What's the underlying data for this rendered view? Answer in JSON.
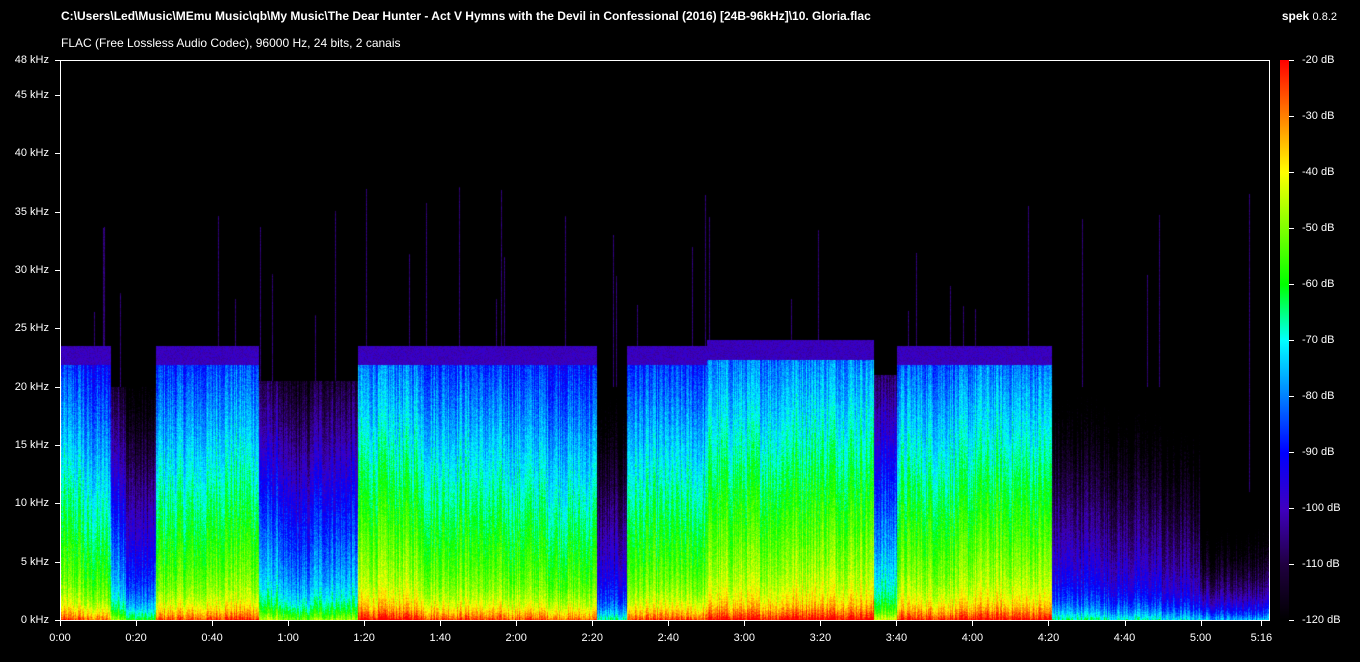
{
  "header": {
    "file_path": "C:\\Users\\Led\\Music\\MEmu Music\\qb\\My Music\\The Dear Hunter - Act V Hymns with the Devil in Confessional (2016) [24B-96kHz]\\10. Gloria.flac",
    "format_info": "FLAC (Free Lossless Audio Codec), 96000 Hz, 24 bits, 2 canais",
    "app_name": "spek",
    "app_version": "0.8.2"
  },
  "chart_data": {
    "type": "heatmap",
    "x_axis": {
      "unit": "time",
      "range_seconds": [
        0,
        318
      ],
      "ticks": [
        {
          "label": "0:00",
          "value": 0
        },
        {
          "label": "0:20",
          "value": 20
        },
        {
          "label": "0:40",
          "value": 40
        },
        {
          "label": "1:00",
          "value": 60
        },
        {
          "label": "1:20",
          "value": 80
        },
        {
          "label": "1:40",
          "value": 100
        },
        {
          "label": "2:00",
          "value": 120
        },
        {
          "label": "2:20",
          "value": 140
        },
        {
          "label": "2:40",
          "value": 160
        },
        {
          "label": "3:00",
          "value": 180
        },
        {
          "label": "3:20",
          "value": 200
        },
        {
          "label": "3:40",
          "value": 220
        },
        {
          "label": "4:00",
          "value": 240
        },
        {
          "label": "4:20",
          "value": 260
        },
        {
          "label": "4:40",
          "value": 280
        },
        {
          "label": "5:00",
          "value": 300
        },
        {
          "label": "5:16",
          "value": 316
        }
      ]
    },
    "y_axis": {
      "unit": "kHz",
      "range": [
        0,
        48
      ],
      "ticks": [
        {
          "label": "0 kHz",
          "value": 0
        },
        {
          "label": "5 kHz",
          "value": 5
        },
        {
          "label": "10 kHz",
          "value": 10
        },
        {
          "label": "15 kHz",
          "value": 15
        },
        {
          "label": "20 kHz",
          "value": 20
        },
        {
          "label": "25 kHz",
          "value": 25
        },
        {
          "label": "30 kHz",
          "value": 30
        },
        {
          "label": "35 kHz",
          "value": 35
        },
        {
          "label": "40 kHz",
          "value": 40
        },
        {
          "label": "45 kHz",
          "value": 45
        },
        {
          "label": "48 kHz",
          "value": 48
        }
      ]
    },
    "colorbar": {
      "unit": "dB",
      "range": [
        -120,
        -20
      ],
      "colors_top_to_bottom": [
        "#ff0000",
        "#ff8000",
        "#ffff00",
        "#80ff00",
        "#00ff00",
        "#00ffff",
        "#0080ff",
        "#0000ff",
        "#4000c0",
        "#200040",
        "#000000"
      ],
      "ticks": [
        {
          "label": "-20 dB",
          "value": -20
        },
        {
          "label": "-30 dB",
          "value": -30
        },
        {
          "label": "-40 dB",
          "value": -40
        },
        {
          "label": "-50 dB",
          "value": -50
        },
        {
          "label": "-60 dB",
          "value": -60
        },
        {
          "label": "-70 dB",
          "value": -70
        },
        {
          "label": "-80 dB",
          "value": -80
        },
        {
          "label": "-90 dB",
          "value": -90
        },
        {
          "label": "-100 dB",
          "value": -100
        },
        {
          "label": "-110 dB",
          "value": -110
        },
        {
          "label": "-120 dB",
          "value": -120
        }
      ]
    },
    "segments": [
      {
        "t_start": 0,
        "t_end": 6,
        "cutoff_khz": 23.5,
        "intensity": 0.72
      },
      {
        "t_start": 6,
        "t_end": 13,
        "cutoff_khz": 23.5,
        "intensity": 0.68
      },
      {
        "t_start": 13,
        "t_end": 17,
        "cutoff_khz": 20,
        "intensity": 0.5
      },
      {
        "t_start": 17,
        "t_end": 25,
        "cutoff_khz": 20,
        "intensity": 0.38
      },
      {
        "t_start": 25,
        "t_end": 40,
        "cutoff_khz": 23.5,
        "intensity": 0.72
      },
      {
        "t_start": 40,
        "t_end": 52,
        "cutoff_khz": 23.5,
        "intensity": 0.75
      },
      {
        "t_start": 52,
        "t_end": 58,
        "cutoff_khz": 20.5,
        "intensity": 0.52
      },
      {
        "t_start": 58,
        "t_end": 66,
        "cutoff_khz": 20.5,
        "intensity": 0.45
      },
      {
        "t_start": 66,
        "t_end": 78,
        "cutoff_khz": 20.5,
        "intensity": 0.5
      },
      {
        "t_start": 78,
        "t_end": 95,
        "cutoff_khz": 23.5,
        "intensity": 0.78
      },
      {
        "t_start": 95,
        "t_end": 110,
        "cutoff_khz": 23.5,
        "intensity": 0.74
      },
      {
        "t_start": 110,
        "t_end": 128,
        "cutoff_khz": 23.5,
        "intensity": 0.72
      },
      {
        "t_start": 128,
        "t_end": 141,
        "cutoff_khz": 23.5,
        "intensity": 0.7
      },
      {
        "t_start": 141,
        "t_end": 149,
        "cutoff_khz": 20,
        "intensity": 0.32
      },
      {
        "t_start": 149,
        "t_end": 170,
        "cutoff_khz": 23.5,
        "intensity": 0.72
      },
      {
        "t_start": 170,
        "t_end": 190,
        "cutoff_khz": 24,
        "intensity": 0.78
      },
      {
        "t_start": 190,
        "t_end": 214,
        "cutoff_khz": 24,
        "intensity": 0.8
      },
      {
        "t_start": 214,
        "t_end": 220,
        "cutoff_khz": 21,
        "intensity": 0.55
      },
      {
        "t_start": 220,
        "t_end": 240,
        "cutoff_khz": 23.5,
        "intensity": 0.76
      },
      {
        "t_start": 240,
        "t_end": 261,
        "cutoff_khz": 23.5,
        "intensity": 0.78
      },
      {
        "t_start": 261,
        "t_end": 275,
        "cutoff_khz": 20,
        "intensity": 0.33
      },
      {
        "t_start": 275,
        "t_end": 290,
        "cutoff_khz": 20,
        "intensity": 0.3
      },
      {
        "t_start": 290,
        "t_end": 300,
        "cutoff_khz": 20,
        "intensity": 0.26
      },
      {
        "t_start": 300,
        "t_end": 318,
        "cutoff_khz": 11,
        "intensity": 0.22
      }
    ]
  }
}
